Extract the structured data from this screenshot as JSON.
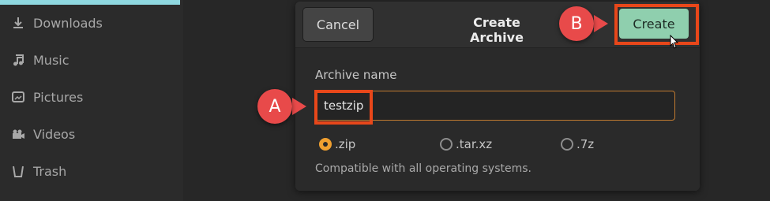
{
  "sidebar": {
    "items": [
      {
        "label": "Downloads",
        "icon": "download-icon"
      },
      {
        "label": "Music",
        "icon": "music-note-icon"
      },
      {
        "label": "Pictures",
        "icon": "image-icon"
      },
      {
        "label": "Videos",
        "icon": "video-camera-icon"
      },
      {
        "label": "Trash",
        "icon": "trash-icon"
      }
    ]
  },
  "dialog": {
    "cancel_label": "Cancel",
    "title": "Create Archive",
    "create_label": "Create",
    "field_label": "Archive name",
    "input_value": "testzip",
    "formats": [
      {
        "label": ".zip",
        "checked": true
      },
      {
        "label": ".tar.xz",
        "checked": false
      },
      {
        "label": ".7z",
        "checked": false
      }
    ],
    "hint": "Compatible with all operating systems."
  },
  "annotations": {
    "a_label": "A",
    "b_label": "B",
    "color": "#e84a4a"
  }
}
